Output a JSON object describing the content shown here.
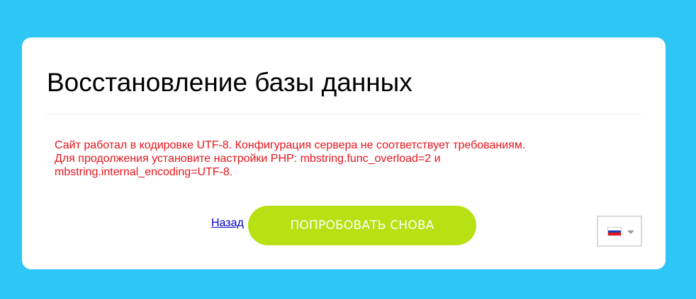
{
  "page": {
    "title": "Восстановление базы данных"
  },
  "error": {
    "lines": [
      "Сайт работал в кодировке UTF-8. Конфигурация сервера не соответствует требованиям.",
      "Для продолжения установите настройки PHP: mbstring.func_overload=2 и",
      "mbstring.internal_encoding=UTF-8."
    ],
    "color": "#e8141b"
  },
  "actions": {
    "back_label": "Назад",
    "retry_label": "ПОПРОБОВАТЬ СНОВА"
  },
  "language": {
    "selected_icon": "russia-flag-icon",
    "dropdown_icon": "caret-down-icon"
  },
  "colors": {
    "background": "#2ec6f5",
    "button": "#b8e012",
    "link": "#0000cc"
  }
}
